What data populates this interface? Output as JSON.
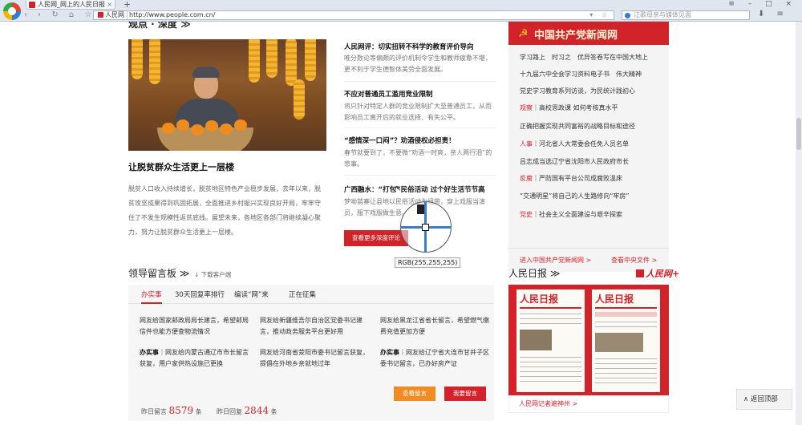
{
  "browser": {
    "tab_title": "人民网_网上的人民日报",
    "tab_close": "×",
    "new_tab": "+",
    "window_controls": "≡ – □ ×",
    "nav_icons": "‹ › ↻ ⌂ ☆",
    "site_chip": "人民网",
    "url": "http://www.people.com.cn/",
    "address_icons": "▾ ☆",
    "search_placeholder": "江歌母亲与媒体见面",
    "tool_icons": "⬇ ≡"
  },
  "feature": {
    "section_title": "观点 · 深度 ≫",
    "hero_title": "让脱贫群众生活更上一层楼",
    "hero_desc": "脱贫人口收入持续增长，脱贫地区特色产业稳步发展，去年以来，脱贫攻坚成果得到巩固拓展，全面推进乡村振兴实现良好开局，牢牢守住了不发生规模性返贫底线。展望未来，各地区各部门将继续凝心聚力，努力让脱贫群众生活更上一层楼。"
  },
  "news": [
    {
      "title": "人民网评：切实扭转不科学的教育评价导向",
      "desc": "唯分数论等偏颇的评价机制令学生和教师疲惫不堪，更不利于学生德智体美劳全面发展。"
    },
    {
      "title": "不应对普通员工滥用竞业限制",
      "desc": "将只针对特定人群的竞业限制扩大至普通员工，从而影响员工离开后的就业选择、有失公平。"
    },
    {
      "title": "“感情深一口闷”？劝酒侵权必担责！",
      "desc": "春节就要到了，不要微“劝酒一时爽，亲人两行泪”的悲事。"
    },
    {
      "title": "广西融水：“打包”民俗活动 过个好生活节节高",
      "desc": "梦呦苗寨让县地以民俗活动为纽带，穿上戏服当演员，服下戏服做生意。"
    }
  ],
  "more_button": "查看更多深度评论",
  "party_news": {
    "header": "中国共产党新闻网",
    "emblem": "☭",
    "items": [
      {
        "tag": "",
        "text": "学习路上　时习之　优异答卷写在中国大地上"
      },
      {
        "tag": "",
        "text": "十九届六中全会学习资料电子书　伟大精神"
      },
      {
        "tag": "",
        "text": "党史学习教育系列访谈，为民统计践初心"
      },
      {
        "tag": "观察",
        "text": "｜高校思政课 如何考核真水平"
      },
      {
        "tag": "",
        "text": "正确把握实现共同富裕的战略目标和途径"
      },
      {
        "tag": "人事",
        "text": "｜河北省人大常委会任免人员名单"
      },
      {
        "tag": "",
        "text": "吕志成当选辽宁省沈阳市人民政府市长"
      },
      {
        "tag": "反腐",
        "text": "｜严防国有平台公司成腐败温床"
      },
      {
        "tag": "",
        "text": "“交通明星”将自己的人生路修向“牢房”"
      },
      {
        "tag": "党史",
        "text": "｜社会主义全面建设与艰辛探索"
      }
    ],
    "footer_left": "进入中国共产党新闻网 >",
    "footer_right": "查看中央文件 >"
  },
  "leader_board": {
    "section_title": "领导留言板 ≫",
    "download": "↓ 下载客户端",
    "tabs": [
      "办实事",
      "30天回复率排行",
      "编读“网”来",
      "正在征集"
    ],
    "messages": [
      {
        "text": "网友给国家邮政局局长建言，希望邮局信件也能方便查物流情况"
      },
      {
        "text": "网友给新疆维吾尔自治区党委书记建言，推动政务服务平台更好用"
      },
      {
        "text": "网友给黑龙江省省长留言，希望燃气缴费充值更加方便"
      },
      {
        "act": "办实事",
        "text": "｜网友给内蒙古通辽市市长留言获复，用户家供热设施已更换"
      },
      {
        "text": "网友给河南省荥阳市委书记留言获复，提倡在外地乡亲就地过年"
      },
      {
        "act": "办实事",
        "text": "｜网友给辽宁省大连市甘井子区委书记留言，已办好房产证"
      }
    ],
    "stats_left_label": "昨日留言",
    "stats_left_value": "8579",
    "stats_right_label": "昨日回复",
    "stats_right_value": "2844",
    "unit": "条",
    "view_button": "查看留言",
    "write_button": "我要留言"
  },
  "daily": {
    "section_title": "人民日报 ≫",
    "logo_text": "人民网+",
    "masthead": "人民日报",
    "footer": "人民网记者遍神州 >"
  },
  "back_to_top": "∧ 返回顶部",
  "color_picker_tip": "RGB(255,255,255)",
  "colors": {
    "brand_red": "#d2232a",
    "orange": "#f08c22",
    "crosshair_blue": "#3a7bc9"
  }
}
